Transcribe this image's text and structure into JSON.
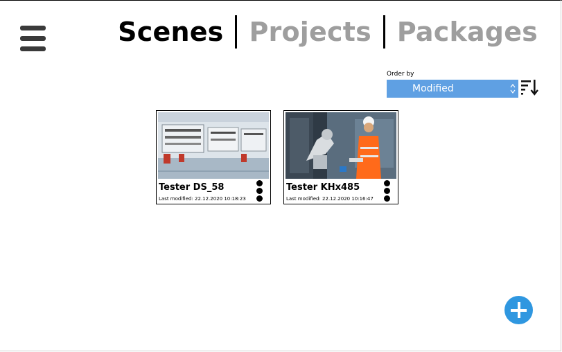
{
  "header": {
    "tabs": [
      {
        "label": "Scenes",
        "active": true
      },
      {
        "label": "Projects",
        "active": false
      },
      {
        "label": "Packages",
        "active": false
      }
    ]
  },
  "toolbar": {
    "order_by_label": "Order by",
    "order_by_value": "Modified",
    "sort_icon": "sort-descending-icon"
  },
  "cards": [
    {
      "title": "Tester DS_58",
      "modified": "Last modified: 22.12.2020 10:18:23",
      "thumbnail": "factory-workstations-photo"
    },
    {
      "title": "Tester KHx485",
      "modified": "Last modified: 22.12.2020 10:16:47",
      "thumbnail": "worker-with-robot-arm-photo"
    }
  ],
  "colors": {
    "accent": "#5fa0e3",
    "fab": "#2f97e0",
    "inactive_tab": "#9e9e9e"
  },
  "actions": {
    "add_icon": "plus-icon",
    "menu_icon": "hamburger-menu-icon",
    "card_menu_icon": "vertical-dots-icon"
  }
}
